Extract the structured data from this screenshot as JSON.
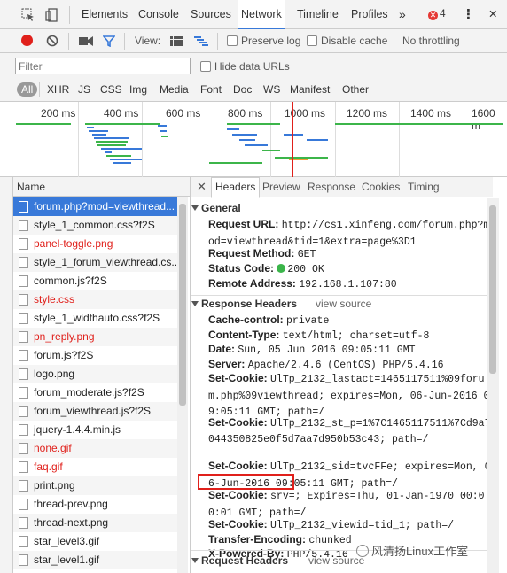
{
  "tabbar": {
    "tabs": [
      "Elements",
      "Console",
      "Sources",
      "Network",
      "Timeline",
      "Profiles"
    ],
    "active_tab": "Network",
    "more": "»",
    "error_count": "4",
    "menu": "⋮",
    "close": "✕"
  },
  "toolbar": {
    "view_label": "View:",
    "preserve_log": "Preserve log",
    "disable_cache": "Disable cache",
    "throttling": "No throttling"
  },
  "filter": {
    "placeholder": "Filter",
    "hide_data_urls": "Hide data URLs"
  },
  "types": [
    "All",
    "XHR",
    "JS",
    "CSS",
    "Img",
    "Media",
    "Font",
    "Doc",
    "WS",
    "Manifest",
    "Other"
  ],
  "overview": {
    "ticks": [
      "200 ms",
      "400 ms",
      "600 ms",
      "800 ms",
      "1000 ms",
      "1200 ms",
      "1400 ms",
      "1600 m"
    ]
  },
  "requests": {
    "header": "Name",
    "items": [
      {
        "name": "forum.php?mod=viewthread...",
        "selected": true,
        "red": false
      },
      {
        "name": "style_1_common.css?f2S",
        "selected": false,
        "red": false
      },
      {
        "name": "panel-toggle.png",
        "selected": false,
        "red": true
      },
      {
        "name": "style_1_forum_viewthread.cs...",
        "selected": false,
        "red": false
      },
      {
        "name": "common.js?f2S",
        "selected": false,
        "red": false
      },
      {
        "name": "style.css",
        "selected": false,
        "red": true
      },
      {
        "name": "style_1_widthauto.css?f2S",
        "selected": false,
        "red": false
      },
      {
        "name": "pn_reply.png",
        "selected": false,
        "red": true
      },
      {
        "name": "forum.js?f2S",
        "selected": false,
        "red": false
      },
      {
        "name": "logo.png",
        "selected": false,
        "red": false
      },
      {
        "name": "forum_moderate.js?f2S",
        "selected": false,
        "red": false
      },
      {
        "name": "forum_viewthread.js?f2S",
        "selected": false,
        "red": false
      },
      {
        "name": "jquery-1.4.4.min.js",
        "selected": false,
        "red": false
      },
      {
        "name": "none.gif",
        "selected": false,
        "red": true
      },
      {
        "name": "faq.gif",
        "selected": false,
        "red": true
      },
      {
        "name": "print.png",
        "selected": false,
        "red": false
      },
      {
        "name": "thread-prev.png",
        "selected": false,
        "red": false
      },
      {
        "name": "thread-next.png",
        "selected": false,
        "red": false
      },
      {
        "name": "star_level3.gif",
        "selected": false,
        "red": false
      },
      {
        "name": "star_level1.gif",
        "selected": false,
        "red": false
      }
    ]
  },
  "detail": {
    "close": "✕",
    "tabs": [
      "Headers",
      "Preview",
      "Response",
      "Cookies",
      "Timing"
    ],
    "active_tab": "Headers",
    "general": {
      "title": "General",
      "request_url_label": "Request URL:",
      "request_url": "http://cs1.xinfeng.com/forum.php?mod=viewthread&tid=1&extra=page%3D1",
      "request_method_label": "Request Method:",
      "request_method": "GET",
      "status_code_label": "Status Code:",
      "status_code": "200 OK",
      "remote_address_label": "Remote Address:",
      "remote_address": "192.168.1.107:80"
    },
    "response_headers": {
      "title": "Response Headers",
      "view_source": "view source",
      "items": [
        {
          "k": "Cache-control:",
          "v": "private"
        },
        {
          "k": "Content-Type:",
          "v": "text/html; charset=utf-8"
        },
        {
          "k": "Date:",
          "v": "Sun, 05 Jun 2016 09:05:11 GMT"
        },
        {
          "k": "Server:",
          "v": "Apache/2.4.6 (CentOS) PHP/5.4.16"
        },
        {
          "k": "Set-Cookie:",
          "v": "UlTp_2132_lastact=1465117511%09forum.php%09viewthread; expires=Mon, 06-Jun-2016 09:05:11 GMT; path=/"
        },
        {
          "k": "Set-Cookie:",
          "v": "UlTp_2132_st_p=1%7C1465117511%7Cd9a7044350825e0f5d7aa7d950b53c43; path=/"
        },
        {
          "k": "Set-Cookie:",
          "v": "UlTp_2132_sid=tvcFFe; expires=Mon, 06-Jun-2016 09:05:11 GMT; path=/"
        },
        {
          "k": "Set-Cookie:",
          "v": "srv=; Expires=Thu, 01-Jan-1970 00:00:01 GMT; path=/"
        },
        {
          "k": "Set-Cookie:",
          "v": "UlTp_2132_viewid=tid_1; path=/"
        },
        {
          "k": "Transfer-Encoding:",
          "v": "chunked"
        },
        {
          "k": "X-Powered-By:",
          "v": "PHP/5.4.16"
        }
      ]
    },
    "request_headers": {
      "title": "Request Headers",
      "view_source": "view source"
    }
  },
  "watermark": "风清扬Linux工作室"
}
